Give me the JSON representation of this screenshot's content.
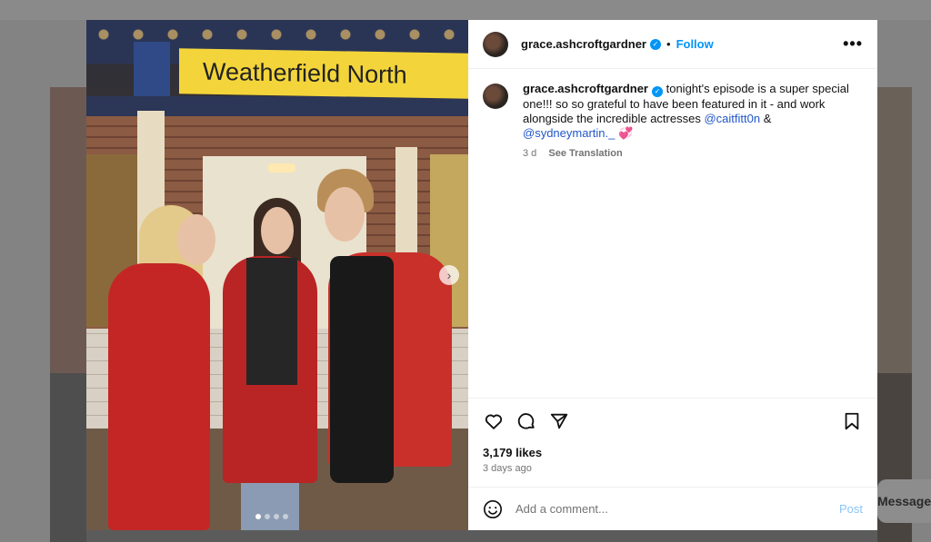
{
  "background": {
    "messages_label": "Messages"
  },
  "photo": {
    "sign_text": "Weatherfield North",
    "carousel_count": 4,
    "carousel_active": 1
  },
  "post": {
    "username": "grace.ashcroftgardner",
    "separator": "•",
    "follow_label": "Follow",
    "more_label": "•••",
    "caption": {
      "username": "grace.ashcroftgardner",
      "text_1": " tonight's episode is a super special one!!! so so grateful to have been featured in it - and work alongside the incredible actresses ",
      "mention_1": "@caitfitt0n",
      "text_2": " & ",
      "mention_2": "@sydneymartin._",
      "emoji": " 💞",
      "age": "3 d",
      "translate_label": "See Translation"
    },
    "likes": "3,179 likes",
    "posted": "3 days ago",
    "comment_placeholder": "Add a comment...",
    "post_label": "Post"
  },
  "colors": {
    "accent": "#0095f6",
    "mention": "#2157c9",
    "post_disabled": "#8cc4f9"
  }
}
